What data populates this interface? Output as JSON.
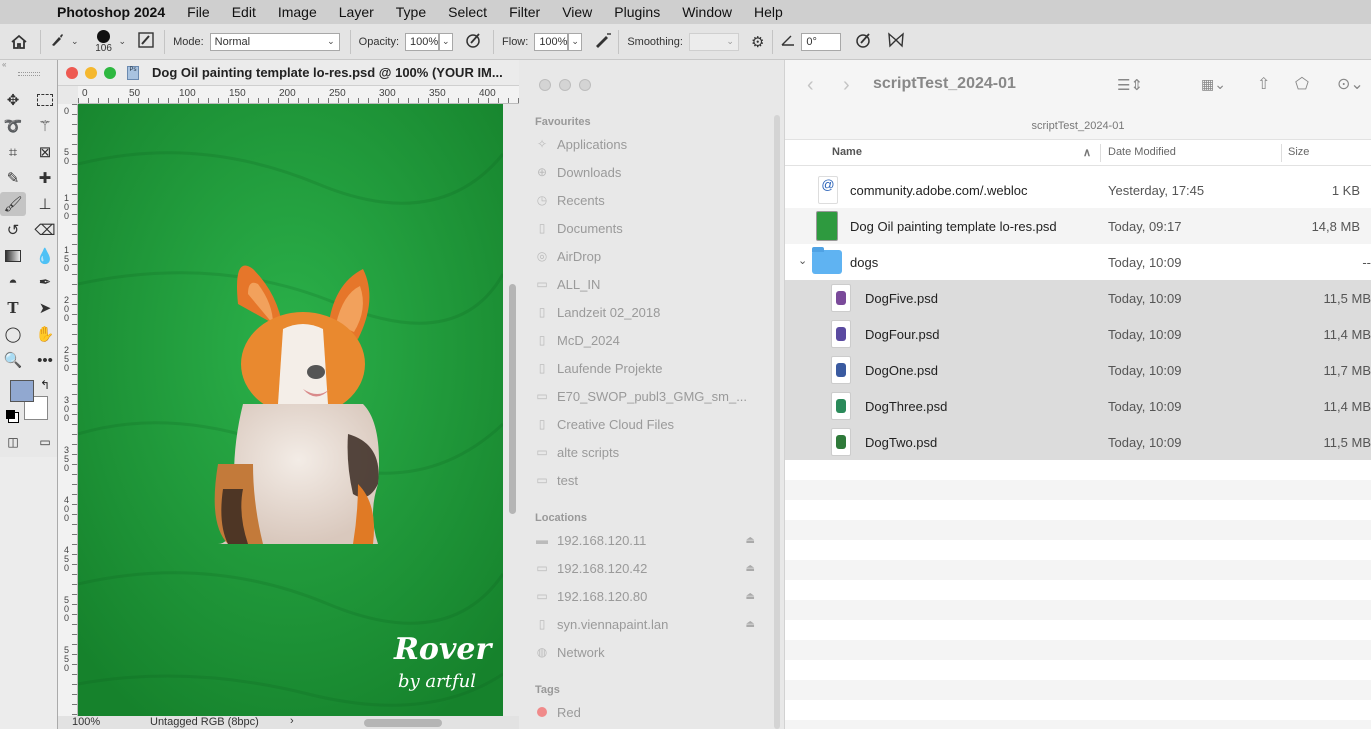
{
  "menubar": {
    "app": "Photoshop 2024",
    "items": [
      "File",
      "Edit",
      "Image",
      "Layer",
      "Type",
      "Select",
      "Filter",
      "View",
      "Plugins",
      "Window",
      "Help"
    ]
  },
  "options": {
    "brush_size": "106",
    "mode_label": "Mode:",
    "mode_value": "Normal",
    "opacity_label": "Opacity:",
    "opacity_value": "100%",
    "flow_label": "Flow:",
    "flow_value": "100%",
    "smoothing_label": "Smoothing:",
    "angle_value": "0°"
  },
  "document": {
    "title": "Dog Oil painting template lo-res.psd @ 100% (YOUR IM...",
    "ruler_h": [
      "0",
      "50",
      "100",
      "150",
      "200",
      "250",
      "300",
      "350",
      "400"
    ],
    "ruler_v": [
      "0",
      "5",
      "0",
      "1",
      "0",
      "0",
      "1",
      "5",
      "0",
      "2",
      "0",
      "0",
      "2",
      "5",
      "0",
      "3",
      "0",
      "0",
      "3",
      "5",
      "0",
      "4",
      "0",
      "0",
      "4",
      "5",
      "0",
      "5",
      "0",
      "0",
      "5",
      "5",
      "0"
    ],
    "zoom": "100%",
    "color_mode": "Untagged RGB (8bpc)",
    "logo_text": "Rover by artful"
  },
  "finder": {
    "title": "scriptTest_2024-01",
    "path": "scriptTest_2024-01",
    "sidebar": {
      "favourites_label": "Favourites",
      "favourites": [
        "Applications",
        "Downloads",
        "Recents",
        "Documents",
        "AirDrop",
        "ALL_IN",
        "Landzeit 02_2018",
        "McD_2024",
        "Laufende Projekte",
        "E70_SWOP_publ3_GMG_sm_...",
        "Creative Cloud Files",
        "alte scripts",
        "test"
      ],
      "locations_label": "Locations",
      "locations": [
        "192.168.120.11",
        "192.168.120.42",
        "192.168.120.80",
        "syn.viennapaint.lan",
        "Network"
      ],
      "tags_label": "Tags",
      "tags": [
        "Red"
      ]
    },
    "columns": {
      "name": "Name",
      "date": "Date Modified",
      "size": "Size"
    },
    "files": [
      {
        "name": "community.adobe.com/.webloc",
        "date": "Yesterday, 17:45",
        "size": "1 KB"
      },
      {
        "name": "Dog Oil painting template lo-res.psd",
        "date": "Today, 09:17",
        "size": "14,8 MB"
      },
      {
        "name": "dogs",
        "date": "Today, 10:09",
        "size": "--"
      },
      {
        "name": "DogFive.psd",
        "date": "Today, 10:09",
        "size": "11,5 MB"
      },
      {
        "name": "DogFour.psd",
        "date": "Today, 10:09",
        "size": "11,4 MB"
      },
      {
        "name": "DogOne.psd",
        "date": "Today, 10:09",
        "size": "11,7 MB"
      },
      {
        "name": "DogThree.psd",
        "date": "Today, 10:09",
        "size": "11,4 MB"
      },
      {
        "name": "DogTwo.psd",
        "date": "Today, 10:09",
        "size": "11,5 MB"
      }
    ]
  },
  "colors": {
    "canvas_green": "#1f9a37",
    "selection": "#dcdcdc",
    "tag_red": "#f08a8a"
  }
}
